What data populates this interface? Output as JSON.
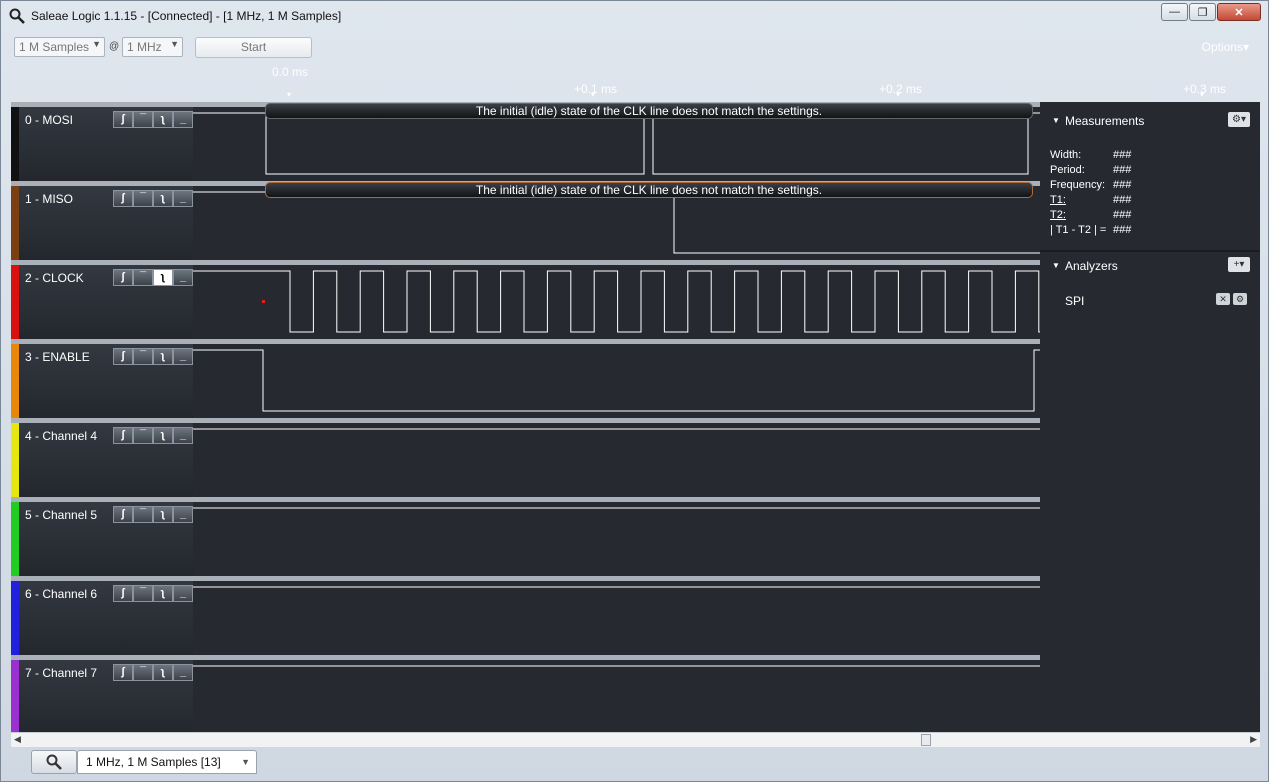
{
  "window": {
    "title": "Saleae Logic 1.1.15 - [Connected] - [1 MHz, 1 M Samples]",
    "minimize": "—",
    "maximize": "❐",
    "close": "✕"
  },
  "toolbar": {
    "samples": "1 M Samples",
    "at": "@",
    "rate": "1 MHz",
    "start_label": "Start",
    "options_label": "Options▾",
    "timeline": [
      "0.0 ms",
      "+0.1 ms",
      "+0.2 ms",
      "+0.3 ms"
    ]
  },
  "channels": [
    {
      "name": "0 - MOSI",
      "color": "#111111"
    },
    {
      "name": "1 - MISO",
      "color": "#7a3f12"
    },
    {
      "name": "2 - CLOCK",
      "color": "#d81010"
    },
    {
      "name": "3 - ENABLE",
      "color": "#e8870c"
    },
    {
      "name": "4 - Channel 4",
      "color": "#e6e611"
    },
    {
      "name": "5 - Channel 5",
      "color": "#22cc22"
    },
    {
      "name": "6 - Channel 6",
      "color": "#2020dd"
    },
    {
      "name": "7 - Channel 7",
      "color": "#9a30d0"
    }
  ],
  "trigger_icons": [
    "rising-edge-icon",
    "high-level-icon",
    "falling-edge-icon",
    "low-level-icon"
  ],
  "warnings": {
    "mosi": "The initial (idle) state of the CLK line does not match the settings.",
    "miso": "The initial (idle) state of the CLK line does not match the settings."
  },
  "measurements": {
    "title": "Measurements",
    "rows": [
      {
        "label": "Width:",
        "value": "###"
      },
      {
        "label": "Period:",
        "value": "###"
      },
      {
        "label": "Frequency:",
        "value": "###"
      },
      {
        "label": "T1:",
        "value": "###"
      },
      {
        "label": "T2:",
        "value": "###"
      },
      {
        "label": "| T1 - T2 | =",
        "value": "###"
      }
    ]
  },
  "analyzers": {
    "title": "Analyzers",
    "items": [
      "SPI"
    ]
  },
  "tabs": {
    "capture": "1 MHz, 1 M Samples [13]"
  }
}
